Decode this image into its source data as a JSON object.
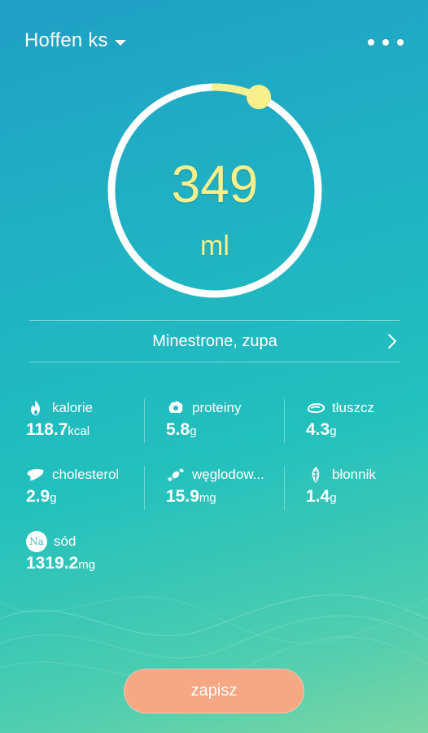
{
  "header": {
    "device_name": "Hoffen ks"
  },
  "gauge": {
    "value": "349",
    "unit": "ml",
    "progress": 0.07
  },
  "food": {
    "name": "Minestrone, zupa"
  },
  "nutrients": [
    {
      "label": "kalorie",
      "value": "118.7",
      "unit": "kcal",
      "icon": "flame-icon"
    },
    {
      "label": "proteiny",
      "value": "5.8",
      "unit": "g",
      "icon": "protein-icon"
    },
    {
      "label": "tłuszcz",
      "value": "4.3",
      "unit": "g",
      "icon": "fat-icon"
    },
    {
      "label": "cholesterol",
      "value": "2.9",
      "unit": "g",
      "icon": "liver-icon"
    },
    {
      "label": "węglodow...",
      "value": "15.9",
      "unit": "mg",
      "icon": "candy-icon"
    },
    {
      "label": "błonnik",
      "value": "1.4",
      "unit": "g",
      "icon": "fiber-icon"
    },
    {
      "label": "sód",
      "value": "1319.2",
      "unit": "mg",
      "icon": "sodium-icon",
      "icon_text": "Na"
    }
  ],
  "actions": {
    "save_label": "zapisz"
  },
  "colors": {
    "accent_yellow": "#f7f08c",
    "save_button": "#f6a784"
  }
}
